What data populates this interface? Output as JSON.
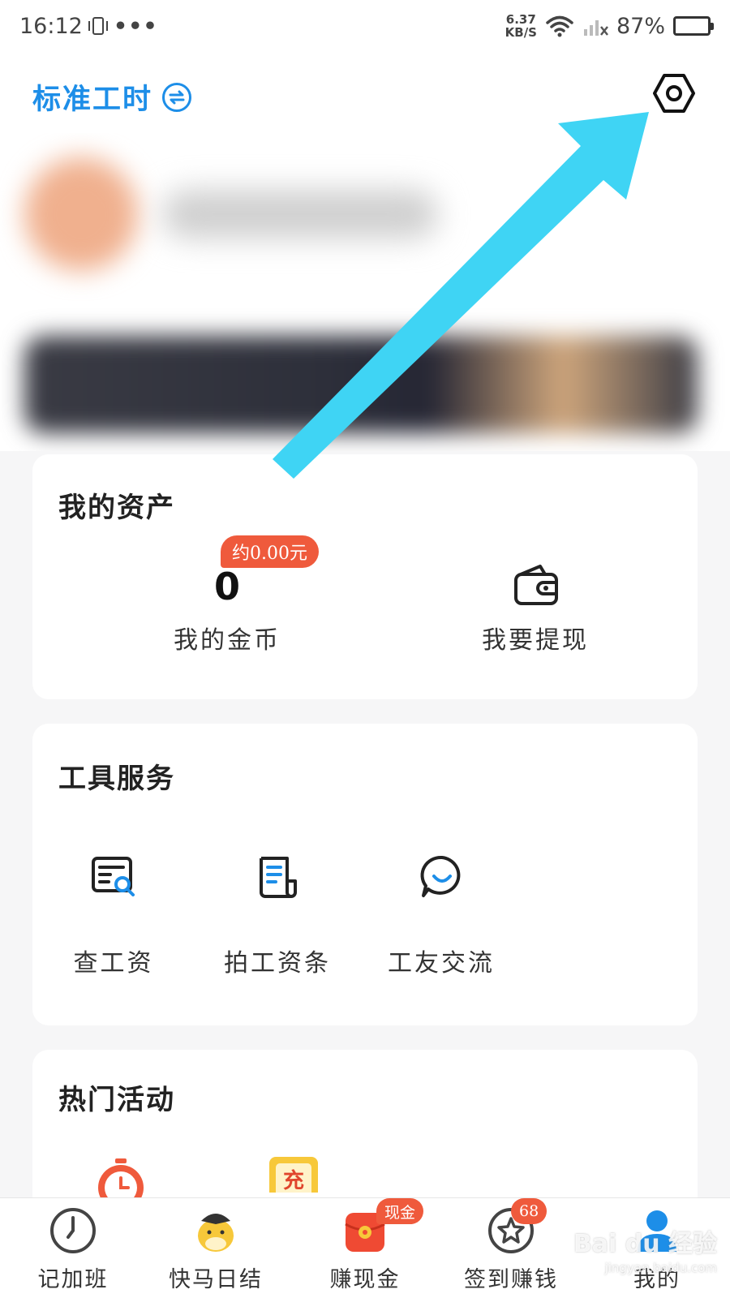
{
  "status_bar": {
    "time": "16:12",
    "more": "•••",
    "net_speed_value": "6.37",
    "net_speed_unit": "KB/S",
    "battery": "87%"
  },
  "header": {
    "mode_title": "标准工时",
    "settings_icon": "settings-hexagon-icon"
  },
  "assets": {
    "title": "我的资产",
    "coin_badge": "约0.00元",
    "coin_value": "0",
    "coin_label": "我的金币",
    "withdraw_label": "我要提现",
    "withdraw_icon": "wallet-icon"
  },
  "tools": {
    "title": "工具服务",
    "items": [
      {
        "label": "查工资",
        "icon": "salary-search-icon"
      },
      {
        "label": "拍工资条",
        "icon": "payslip-icon"
      },
      {
        "label": "工友交流",
        "icon": "chat-bubble-icon"
      }
    ]
  },
  "events": {
    "title": "热门活动",
    "items": [
      {
        "icon": "alarm-clock-icon"
      },
      {
        "icon": "recharge-icon",
        "glyph": "充"
      }
    ]
  },
  "tabbar": {
    "items": [
      {
        "label": "记加班",
        "icon": "clock-icon"
      },
      {
        "label": "快马日结",
        "icon": "horse-mascot-icon"
      },
      {
        "label": "赚现金",
        "icon": "red-envelope-icon",
        "badge": "现金"
      },
      {
        "label": "签到赚钱",
        "icon": "star-checkin-icon",
        "badge": "68"
      },
      {
        "label": "我的",
        "icon": "user-icon",
        "active": true
      }
    ]
  },
  "watermark": {
    "main": "Bai du 经验",
    "sub": "jingyan.baidu.com"
  },
  "colors": {
    "brand_blue": "#1d8ee8",
    "badge_red": "#ef5a3c",
    "annotation_arrow": "#3fd4f4",
    "background": "#f6f6f7"
  }
}
